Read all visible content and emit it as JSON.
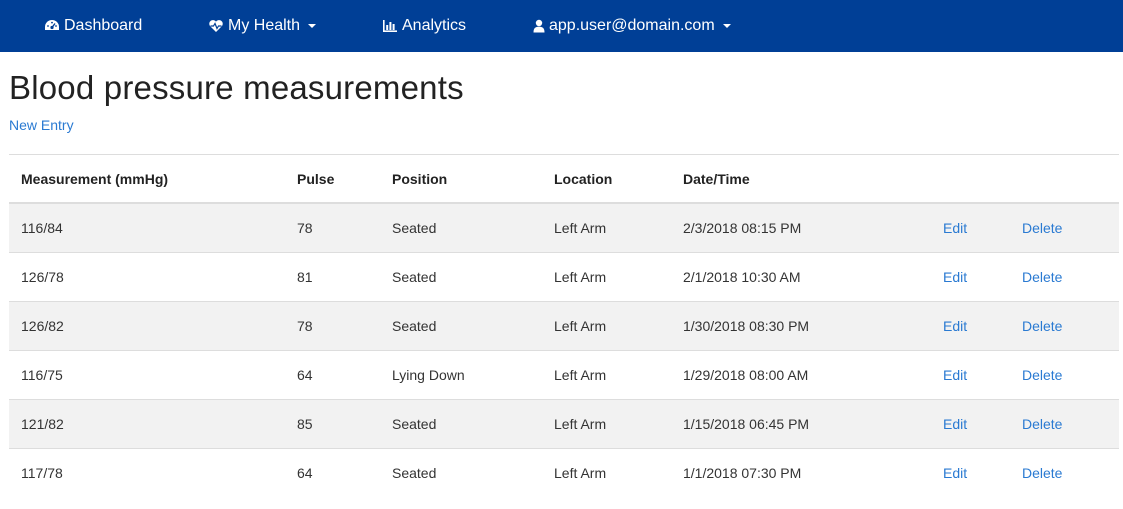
{
  "nav": {
    "dashboard": "Dashboard",
    "my_health": "My Health",
    "analytics": "Analytics",
    "user": "app.user@domain.com"
  },
  "page": {
    "title": "Blood pressure measurements",
    "new_entry": "New Entry"
  },
  "table": {
    "headers": [
      "Measurement (mmHg)",
      "Pulse",
      "Position",
      "Location",
      "Date/Time"
    ],
    "rows": [
      {
        "measurement": "116/84",
        "pulse": "78",
        "position": "Seated",
        "location": "Left Arm",
        "datetime": "2/3/2018 08:15 PM",
        "edit": "Edit",
        "delete": "Delete"
      },
      {
        "measurement": "126/78",
        "pulse": "81",
        "position": "Seated",
        "location": "Left Arm",
        "datetime": "2/1/2018 10:30 AM",
        "edit": "Edit",
        "delete": "Delete"
      },
      {
        "measurement": "126/82",
        "pulse": "78",
        "position": "Seated",
        "location": "Left Arm",
        "datetime": "1/30/2018 08:30 PM",
        "edit": "Edit",
        "delete": "Delete"
      },
      {
        "measurement": "116/75",
        "pulse": "64",
        "position": "Lying Down",
        "location": "Left Arm",
        "datetime": "1/29/2018 08:00 AM",
        "edit": "Edit",
        "delete": "Delete"
      },
      {
        "measurement": "121/82",
        "pulse": "85",
        "position": "Seated",
        "location": "Left Arm",
        "datetime": "1/15/2018 06:45 PM",
        "edit": "Edit",
        "delete": "Delete"
      },
      {
        "measurement": "117/78",
        "pulse": "64",
        "position": "Seated",
        "location": "Left Arm",
        "datetime": "1/1/2018 07:30 PM",
        "edit": "Edit",
        "delete": "Delete"
      }
    ]
  },
  "colors": {
    "navbar": "#003f96",
    "link": "#2a7ad2",
    "stripe": "#f2f2f2"
  },
  "icons": {
    "dashboard": "dashboard-icon",
    "my_health": "heartbeat-icon",
    "analytics": "bar-chart-icon",
    "user": "user-icon"
  }
}
